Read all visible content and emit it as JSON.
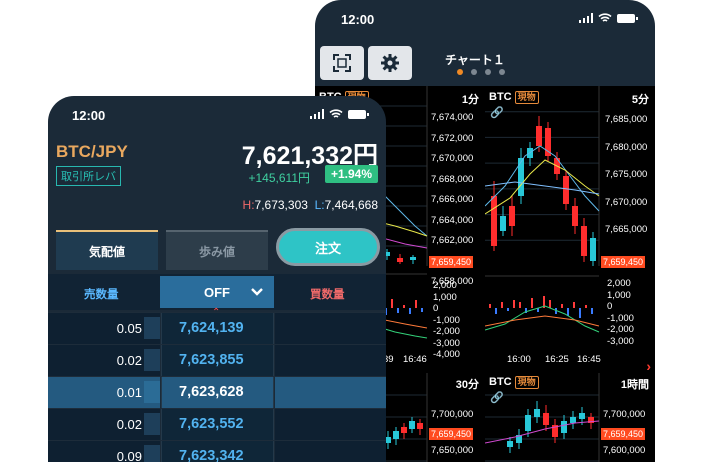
{
  "back_phone": {
    "status_time": "12:00",
    "toolbar": {
      "chart_name": "チャート１",
      "page_dots": 4,
      "active_dot": 0
    },
    "panels": [
      {
        "symbol": "BTC",
        "badge": "現物",
        "timeframe": "1分",
        "y_labels": [
          "7,674,000",
          "7,672,000",
          "7,670,000",
          "7,668,000",
          "7,666,000",
          "7,664,000",
          "7,662,000",
          "7,660,000",
          "7,658,000"
        ],
        "price_label": "7,659,450",
        "osc_labels": [
          "2,000",
          "1,000",
          "0",
          "-1,000",
          "-2,000",
          "-3,000",
          "-4,000"
        ],
        "x_labels": [
          "39",
          "16:46"
        ]
      },
      {
        "symbol": "BTC",
        "badge": "現物",
        "timeframe": "5分",
        "y_labels": [
          "7,685,000",
          "7,680,000",
          "7,675,000",
          "7,670,000",
          "7,665,000"
        ],
        "price_label": "7,659,450",
        "osc_labels": [
          "2,000",
          "1,000",
          "0",
          "-1,000",
          "-2,000",
          "-3,000"
        ],
        "x_labels": [
          "16:00",
          "16:25",
          "16:45"
        ]
      },
      {
        "symbol": "BTC",
        "badge": "",
        "timeframe": "30分",
        "y_labels": [
          "7,700,000",
          "7,659,450",
          "7,650,000"
        ],
        "price_label": "7,659,450"
      },
      {
        "symbol": "BTC",
        "badge": "現物",
        "timeframe": "1時間",
        "y_labels": [
          "7,700,000",
          "7,659,450",
          "7,600,000"
        ],
        "price_label": "7,659,450"
      }
    ]
  },
  "front_phone": {
    "status_time": "12:00",
    "pair": "BTC/JPY",
    "last_price": "7,621,332円",
    "market_tag": "取引所レバ",
    "change": "+145,611円",
    "change_pct": "+1.94%",
    "high_label": "H:",
    "high": "7,673,303",
    "low_label": "L:",
    "low": "7,464,668",
    "tabs": {
      "board": "気配値",
      "trades": "歩み値",
      "order": "注文"
    },
    "columns": {
      "sell_qty": "売数量",
      "filter": "OFF",
      "buy_qty": "買数量"
    },
    "rows": [
      {
        "qty": "0.05",
        "price": "7,624,139"
      },
      {
        "qty": "0.02",
        "price": "7,623,855"
      },
      {
        "qty": "0.01",
        "price": "7,623,628"
      },
      {
        "qty": "0.02",
        "price": "7,623,552"
      },
      {
        "qty": "0.09",
        "price": "7,623,342"
      }
    ]
  },
  "colors": {
    "up_candle": "#28c8d8",
    "down_candle": "#ff2d2d",
    "accent": "#2ec4c6",
    "price_tag": "#ff4b20"
  }
}
